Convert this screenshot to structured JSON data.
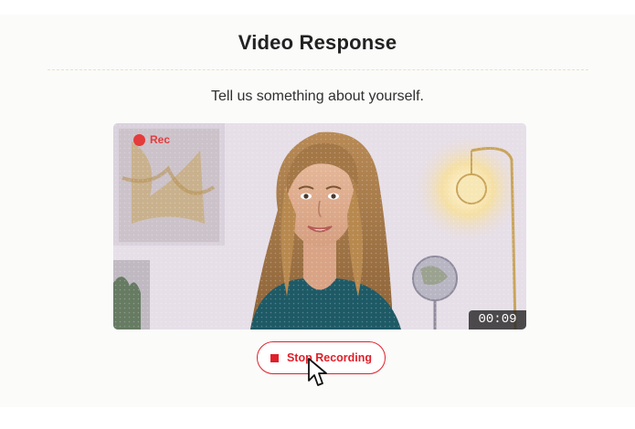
{
  "header": {
    "title": "Video Response"
  },
  "question": {
    "prompt": "Tell us something about yourself."
  },
  "video": {
    "recording_label": "Rec",
    "timer": "00:09",
    "recording_color": "#e43b3b"
  },
  "controls": {
    "stop_label": "Stop Recording",
    "accent_color": "#e0202a"
  },
  "icons": {
    "recording": "record-dot-icon",
    "stop": "stop-square-icon",
    "pointer": "mouse-pointer-icon"
  }
}
